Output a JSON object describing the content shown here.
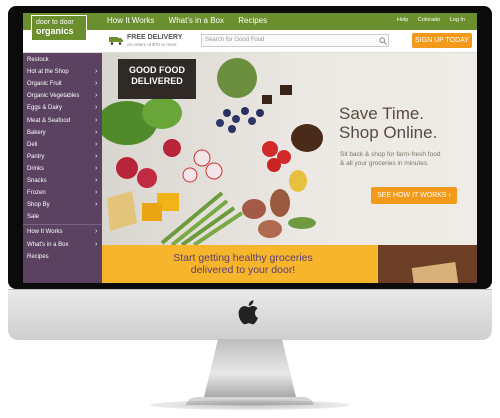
{
  "site": {
    "logo_line1": "door to door",
    "logo_line2": "organics",
    "topnav": [
      "How It Works",
      "What's in a Box",
      "Recipes"
    ],
    "topright": [
      "Help",
      "Colorado",
      "Log In"
    ]
  },
  "delivery": {
    "title": "FREE DELIVERY",
    "subtitle": "on orders of $70 or more"
  },
  "search": {
    "placeholder": "Search for Good Food"
  },
  "signup_button": "SIGN UP TODAY",
  "sidebar": {
    "items": [
      {
        "label": "Restock",
        "arrow": false
      },
      {
        "label": "Hot at the Shop",
        "arrow": true
      },
      {
        "label": "Organic Fruit",
        "arrow": true
      },
      {
        "label": "Organic Vegetables",
        "arrow": true
      },
      {
        "label": "Eggs & Dairy",
        "arrow": true
      },
      {
        "label": "Meat & Seafood",
        "arrow": true
      },
      {
        "label": "Bakery",
        "arrow": true
      },
      {
        "label": "Deli",
        "arrow": true
      },
      {
        "label": "Pantry",
        "arrow": true
      },
      {
        "label": "Drinks",
        "arrow": true
      },
      {
        "label": "Snacks",
        "arrow": true
      },
      {
        "label": "Frozen",
        "arrow": true
      },
      {
        "label": "Shop By",
        "arrow": true
      },
      {
        "label": "Sale",
        "arrow": false
      },
      {
        "label": "How It Works",
        "arrow": true
      },
      {
        "label": "What's in a Box",
        "arrow": true
      },
      {
        "label": "Recipes",
        "arrow": false
      }
    ]
  },
  "hero": {
    "badge_line1": "GOOD FOOD",
    "badge_line2": "DELIVERED",
    "title_line1": "Save Time.",
    "title_line2": "Shop Online.",
    "sub_line1": "Sit back & shop for farm-fresh food",
    "sub_line2": "& all your groceries in minutes.",
    "cta": "SEE HOW IT WORKS"
  },
  "promo": {
    "line1": "Start getting healthy groceries",
    "line2": "delivered to your door!"
  },
  "colors": {
    "green": "#6a8f2c",
    "purple": "#5a4260",
    "orange": "#f39a1b",
    "yellow": "#f6b52a"
  }
}
